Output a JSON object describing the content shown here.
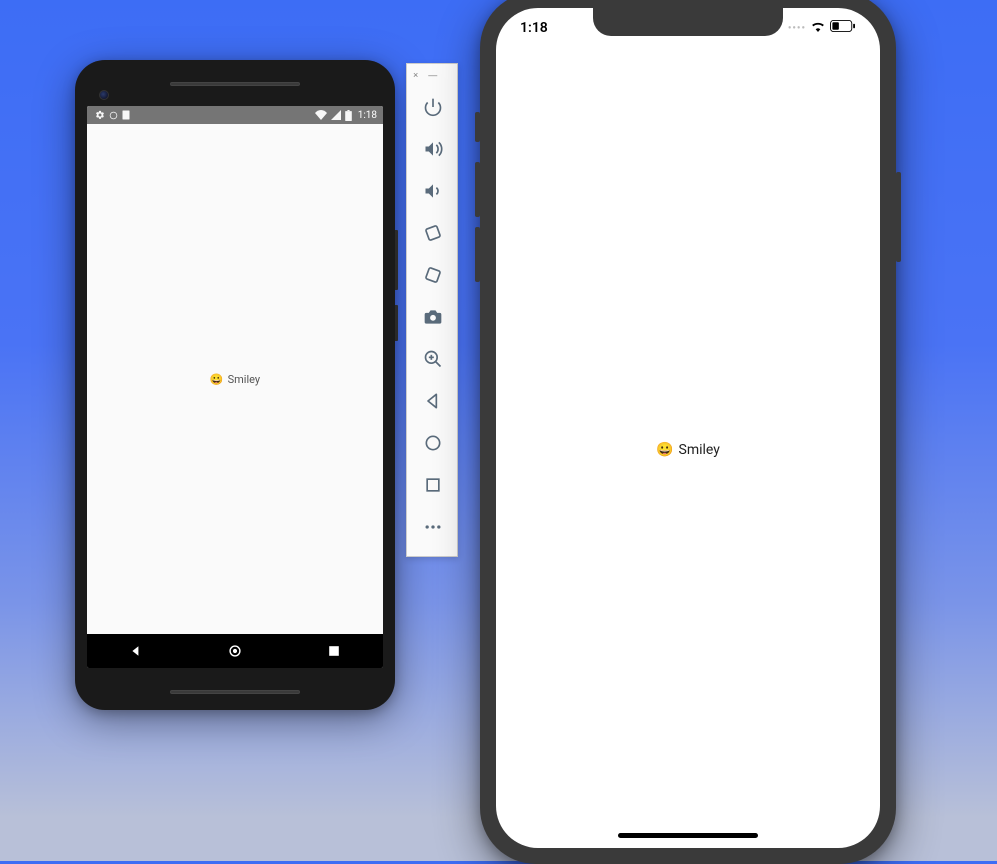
{
  "android": {
    "status_time": "1:18",
    "content_emoji": "😀",
    "content_label": "Smiley"
  },
  "iphone": {
    "status_time": "1:18",
    "content_emoji": "😀",
    "content_label": "Smiley"
  },
  "emulator_toolbar": {
    "window_close": "×",
    "window_min": "—",
    "tools": [
      {
        "name": "power"
      },
      {
        "name": "volume-up"
      },
      {
        "name": "volume-down"
      },
      {
        "name": "rotate-left"
      },
      {
        "name": "rotate-right"
      },
      {
        "name": "screenshot"
      },
      {
        "name": "zoom"
      },
      {
        "name": "back"
      },
      {
        "name": "home"
      },
      {
        "name": "overview"
      },
      {
        "name": "more"
      }
    ]
  }
}
